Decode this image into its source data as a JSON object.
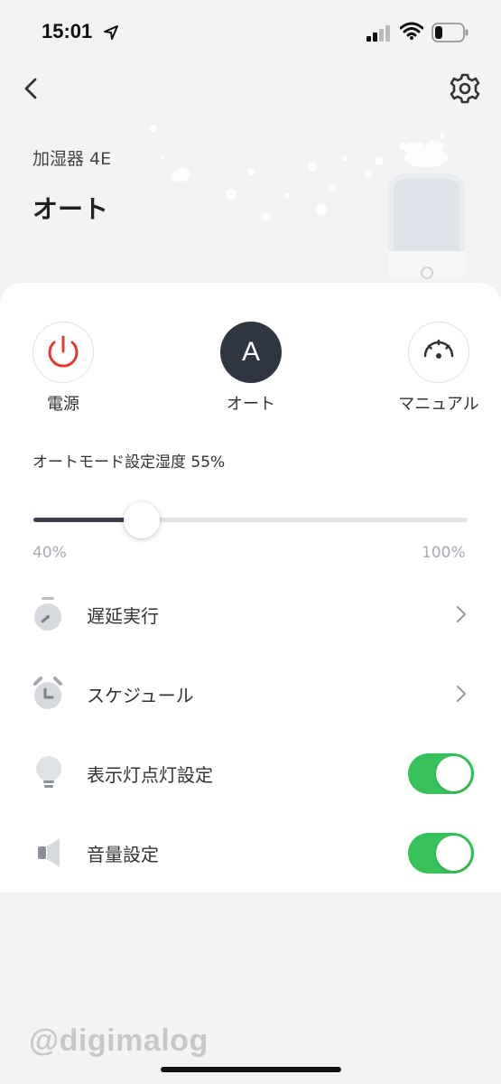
{
  "status_bar": {
    "time": "15:01"
  },
  "header": {
    "device_name": "加湿器 4E",
    "mode_title": "オート"
  },
  "modes": [
    {
      "label": "電源",
      "icon": "power-icon",
      "color": "#e03a34"
    },
    {
      "label": "オート",
      "glyph": "A",
      "selected": true
    },
    {
      "label": "マニュアル",
      "icon": "gauge-icon"
    }
  ],
  "humidity": {
    "label": "オートモード設定湿度 55%",
    "min_label": "40%",
    "max_label": "100%",
    "min": 40,
    "max": 100,
    "value": 55
  },
  "rows": [
    {
      "label": "遅延実行",
      "icon": "stopwatch-icon",
      "control": "chevron"
    },
    {
      "label": "スケジュール",
      "icon": "alarm-clock-icon",
      "control": "chevron"
    },
    {
      "label": "表示灯点灯設定",
      "icon": "light-bulb-icon",
      "control": "toggle",
      "on": true
    },
    {
      "label": "音量設定",
      "icon": "speaker-icon",
      "control": "toggle",
      "on": true
    }
  ],
  "colors": {
    "accent_green": "#36c159",
    "power_red": "#e03a34",
    "dark": "#2f3541"
  },
  "watermark": "@digimalog"
}
